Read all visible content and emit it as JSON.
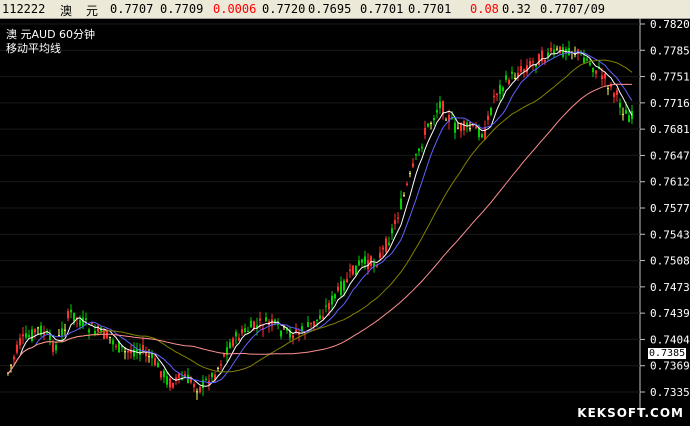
{
  "quote_bar": {
    "code": "112222",
    "name_1": "澳",
    "name_2": "元",
    "open": "0.7707",
    "prev_close": "0.7709",
    "change": "0.0006",
    "high": "0.7720",
    "low": "0.7695",
    "bid": "0.7701",
    "ask": "0.7701",
    "pct": "0.08",
    "amp": "0.32",
    "date": "0.7707/09",
    "colors": {
      "up": "#ff0000",
      "normal": "#000000"
    }
  },
  "chart_header": {
    "title": "澳    元AUD    60分钟",
    "indicator": "移动平均线"
  },
  "price_axis": [
    "0.7820",
    "0.7785",
    "0.7751",
    "0.7716",
    "0.7681",
    "0.7647",
    "0.7612",
    "0.7577",
    "0.7543",
    "0.7508",
    "0.7473",
    "0.7439",
    "0.7404",
    "0.7369",
    "0.7335"
  ],
  "current_price_tag": "0.7385",
  "watermark": "KEKSOFT.COM",
  "chart_data": {
    "type": "line",
    "ylim": [
      0.7335,
      0.782
    ],
    "candle_colors": {
      "up": "#ff3030",
      "down": "#00d000",
      "doji": "#ffff60"
    },
    "ma_colors": [
      "#ffffff",
      "#6060ff",
      "#808000",
      "#ff9090"
    ]
  }
}
